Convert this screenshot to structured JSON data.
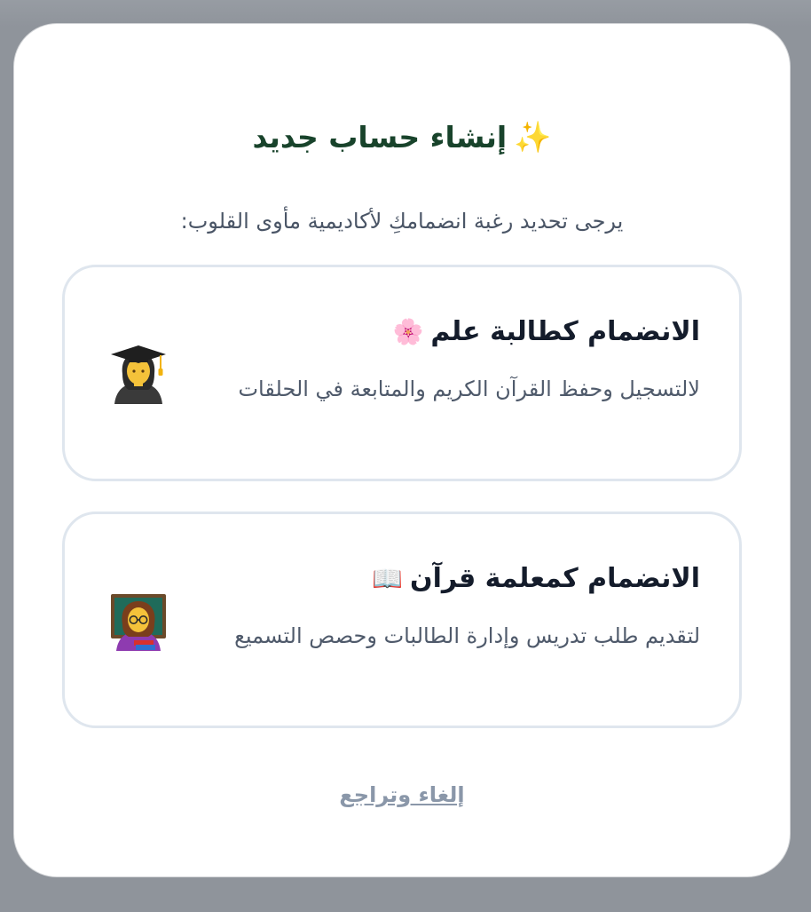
{
  "modal": {
    "title": "إنشاء حساب جديد",
    "title_icon": "✨",
    "subtitle": "يرجى تحديد رغبة انضمامكِ لأكاديمية مأوى القلوب:",
    "options": [
      {
        "title": "الانضمام كطالبة علم",
        "title_icon": "🌸",
        "description": "لالتسجيل وحفظ القرآن الكريم والمتابعة في الحلقات",
        "avatar_icon": "student-graduate-icon"
      },
      {
        "title": "الانضمام كمعلمة قرآن",
        "title_icon": "📖",
        "description": "لتقديم طلب تدريس وإدارة الطالبات وحصص التسميع",
        "avatar_icon": "teacher-icon"
      }
    ],
    "cancel_label": "إلغاء وتراجع"
  },
  "colors": {
    "backdrop": "#8f949b",
    "title": "#18432b",
    "card_border": "#dfe6ee",
    "cancel": "#8a97a9"
  }
}
